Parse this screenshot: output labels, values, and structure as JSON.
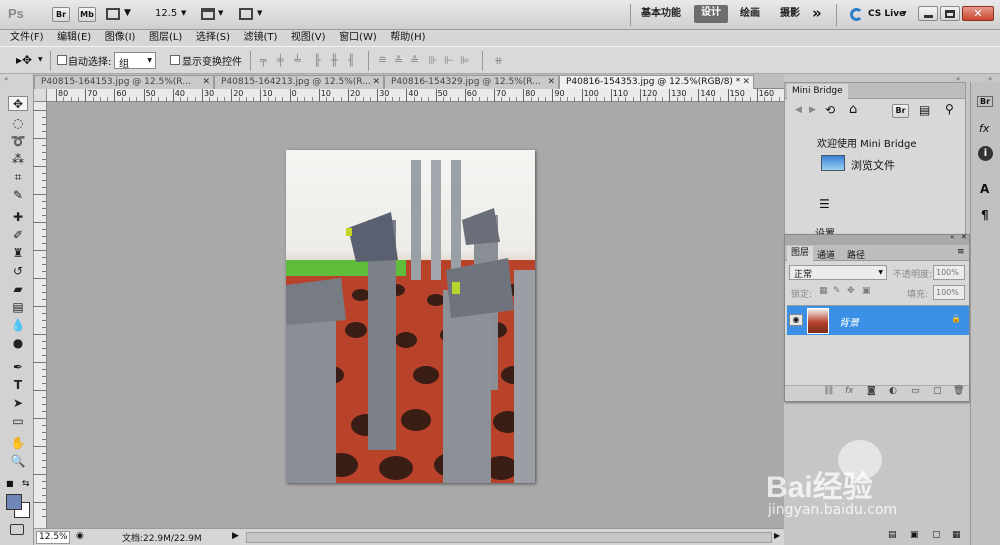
{
  "app": {
    "logo": "Ps",
    "bridge_badge": "Br",
    "minibridge_badge": "Mb",
    "zoom_select": "12.5",
    "workspaces": [
      "基本功能",
      "设计",
      "绘画",
      "摄影"
    ],
    "more_label": "»",
    "cs_live": "CS Live"
  },
  "menu": [
    "文件(F)",
    "编辑(E)",
    "图像(I)",
    "图层(L)",
    "选择(S)",
    "滤镜(T)",
    "视图(V)",
    "窗口(W)",
    "帮助(H)"
  ],
  "options": {
    "auto_select_label": "自动选择:",
    "auto_select_value": "组",
    "show_transform_label": "显示变换控件"
  },
  "tabs": [
    {
      "label": "P40815-164153.jpg @ 12.5%(R..."
    },
    {
      "label": "P40815-164213.jpg @ 12.5%(R..."
    },
    {
      "label": "P40816-154329.jpg @ 12.5%(R..."
    },
    {
      "label": "P40816-154353.jpg @ 12.5%(RGB/8) *"
    }
  ],
  "ruler_top": [
    "80",
    "70",
    "60",
    "50",
    "40",
    "30",
    "20",
    "10",
    "0",
    "10",
    "20",
    "30",
    "40",
    "50",
    "60",
    "70",
    "80",
    "90",
    "100",
    "110",
    "120",
    "130",
    "140",
    "150",
    "160"
  ],
  "status": {
    "zoom": "12.5%",
    "doc": "文档:22.9M/22.9M"
  },
  "mini_bridge": {
    "title": "Mini Bridge",
    "welcome": "欢迎使用 Mini Bridge",
    "browse": "浏览文件",
    "settings": "设置",
    "br_badge": "Br"
  },
  "layers": {
    "tabs": [
      "图层",
      "通道",
      "路径"
    ],
    "blend_mode": "正常",
    "opacity_label": "不透明度:",
    "opacity_value": "100%",
    "lock_label": "锁定:",
    "fill_label": "填充:",
    "fill_value": "100%",
    "layer_name": "背景"
  },
  "colors": {
    "selection_blue": "#3a8fe6",
    "workspace_active": "#6d6d6d",
    "canvas_bg": "#a9a9a9"
  },
  "watermark": {
    "brand": "Bai经验",
    "url": "jingyan.baidu.com"
  }
}
